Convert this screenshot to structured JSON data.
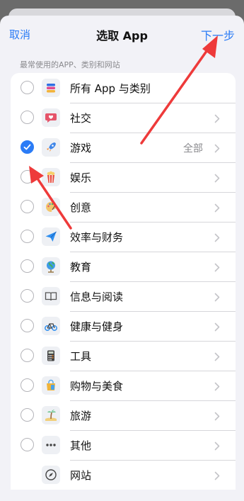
{
  "nav": {
    "cancel_label": "取消",
    "title": "选取 App",
    "next_label": "下一步"
  },
  "section_header": "最常使用的APP、类别和网站",
  "rows": [
    {
      "label": "所有 App 与类别",
      "value": "",
      "icon": "stack-icon",
      "checked": false,
      "has_radio": true,
      "has_chevron": false
    },
    {
      "label": "社交",
      "value": "",
      "icon": "chat-bubble-heart-icon",
      "checked": false,
      "has_radio": true,
      "has_chevron": true
    },
    {
      "label": "游戏",
      "value": "全部",
      "icon": "rocket-icon",
      "checked": true,
      "has_radio": true,
      "has_chevron": true
    },
    {
      "label": "娱乐",
      "value": "",
      "icon": "popcorn-icon",
      "checked": false,
      "has_radio": true,
      "has_chevron": true
    },
    {
      "label": "创意",
      "value": "",
      "icon": "palette-icon",
      "checked": false,
      "has_radio": true,
      "has_chevron": true
    },
    {
      "label": "效率与财务",
      "value": "",
      "icon": "paper-plane-icon",
      "checked": false,
      "has_radio": true,
      "has_chevron": true
    },
    {
      "label": "教育",
      "value": "",
      "icon": "globe-icon",
      "checked": false,
      "has_radio": true,
      "has_chevron": true
    },
    {
      "label": "信息与阅读",
      "value": "",
      "icon": "book-icon",
      "checked": false,
      "has_radio": true,
      "has_chevron": true
    },
    {
      "label": "健康与健身",
      "value": "",
      "icon": "bicycle-icon",
      "checked": false,
      "has_radio": true,
      "has_chevron": true
    },
    {
      "label": "工具",
      "value": "",
      "icon": "calculator-icon",
      "checked": false,
      "has_radio": true,
      "has_chevron": true
    },
    {
      "label": "购物与美食",
      "value": "",
      "icon": "shopping-bag-icon",
      "checked": false,
      "has_radio": true,
      "has_chevron": true
    },
    {
      "label": "旅游",
      "value": "",
      "icon": "palm-tree-icon",
      "checked": false,
      "has_radio": true,
      "has_chevron": true
    },
    {
      "label": "其他",
      "value": "",
      "icon": "ellipsis-icon",
      "checked": false,
      "has_radio": true,
      "has_chevron": true
    },
    {
      "label": "网站",
      "value": "",
      "icon": "compass-icon",
      "checked": false,
      "has_radio": false,
      "has_chevron": true
    }
  ],
  "colors": {
    "accent": "#2b7cf6",
    "annotation_arrow": "#ee3a3a"
  }
}
